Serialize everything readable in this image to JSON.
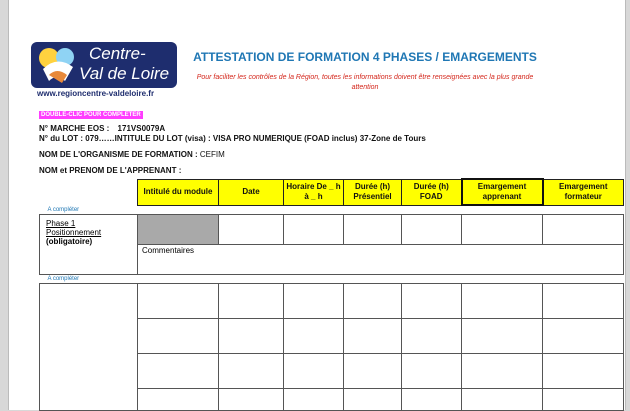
{
  "logo": {
    "line1": "Centre-",
    "line2": "Val de Loire",
    "url": "www.regioncentre-valdeloire.fr"
  },
  "title": "ATTESTATION DE FORMATION 4 PHASES / EMARGEMENTS",
  "subtitle": "Pour faciliter les contrôles de la Région, toutes les informations doivent être renseignées avec la plus grande attention",
  "badge": "DOUBLE-CLIC POUR COMPLETER",
  "info": {
    "marche_label": "N° MARCHE EOS :",
    "marche_value": "171VS0079A",
    "lot_label": "N° du LOT : 079……INTITULE DU LOT (visa) : VISA PRO NUMERIQUE (FOAD inclus) 37-Zone de Tours",
    "organisme_label": "NOM DE L'ORGANISME DE FORMATION :",
    "organisme_value": "CEFIM",
    "apprenant_label": "NOM et PRENOM DE L'APPRENANT :"
  },
  "table": {
    "headers": [
      "Intitulé du module",
      "Date",
      "Horaire De _ h à _ h",
      "Durée (h) Présentiel",
      "Durée (h) FOAD",
      "Emargement apprenant",
      "Emargement formateur"
    ],
    "a_completer_1": "A compléter",
    "a_completer_2": "A compléter",
    "phase1_line1": "Phase 1",
    "phase1_line2": "Positionnement",
    "phase1_line3": "(obligatoire)",
    "commentaires": "Commentaires"
  },
  "colors": {
    "header_fill": "#ffff00",
    "title": "#1f77b4",
    "subtitle": "#d4271c",
    "badge": "#ff3dff"
  }
}
